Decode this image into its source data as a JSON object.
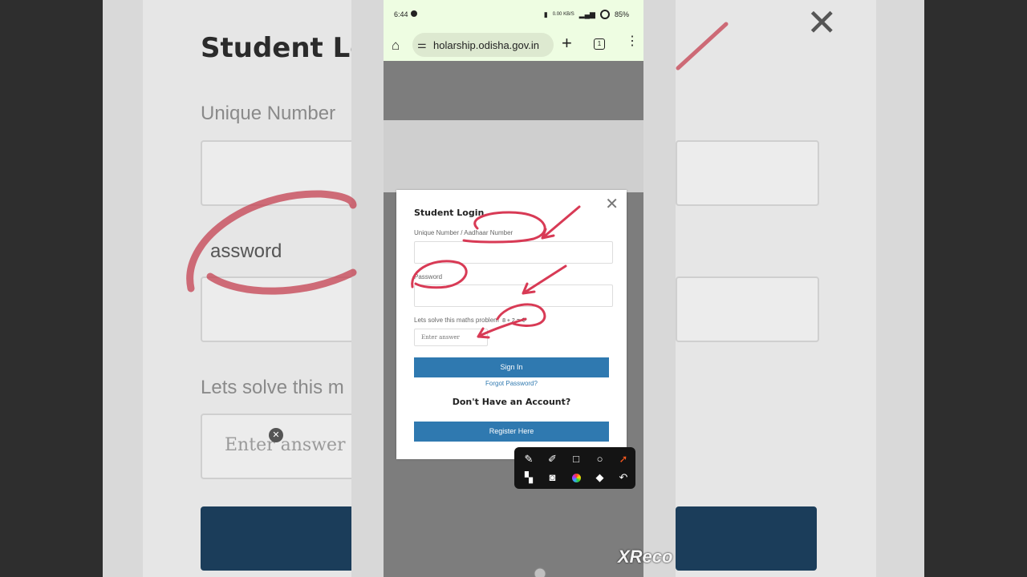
{
  "browser": {
    "status_time": "6:44",
    "status_right": "0.00 KB/S",
    "battery": "85%",
    "url_text": "holarship.odisha.gov.in",
    "tab_count": "1"
  },
  "login": {
    "title": "Student Login",
    "unique_label": "Unique Number / Aadhaar Number",
    "password_label": "Password",
    "captcha_label": "Lets solve this maths problem",
    "captcha_value": "8 + 2 =",
    "answer_placeholder": "Enter answer",
    "sign_in_label": "Sign In",
    "forgot_label": "Forgot Password?",
    "no_account_heading": "Don't Have an Account?",
    "register_label": "Register Here"
  },
  "background": {
    "title": "Student Log",
    "unique_label": "Unique Number",
    "password_label": "assword",
    "captcha_label": "Lets solve this m",
    "answer_placeholder": "Enter answer"
  },
  "toolbar": {
    "tools_row1": [
      "brush-icon",
      "magic-pen-icon",
      "rectangle-icon",
      "circle-icon",
      "arrow-icon"
    ],
    "tools_row2": [
      "mosaic-icon",
      "camera-icon",
      "color-picker-icon",
      "eraser-icon",
      "undo-icon"
    ]
  },
  "watermark": "XReco",
  "colors": {
    "annotation": "#d83a55",
    "primary_button": "#2f79b0",
    "browser_bar": "#eefde2"
  }
}
